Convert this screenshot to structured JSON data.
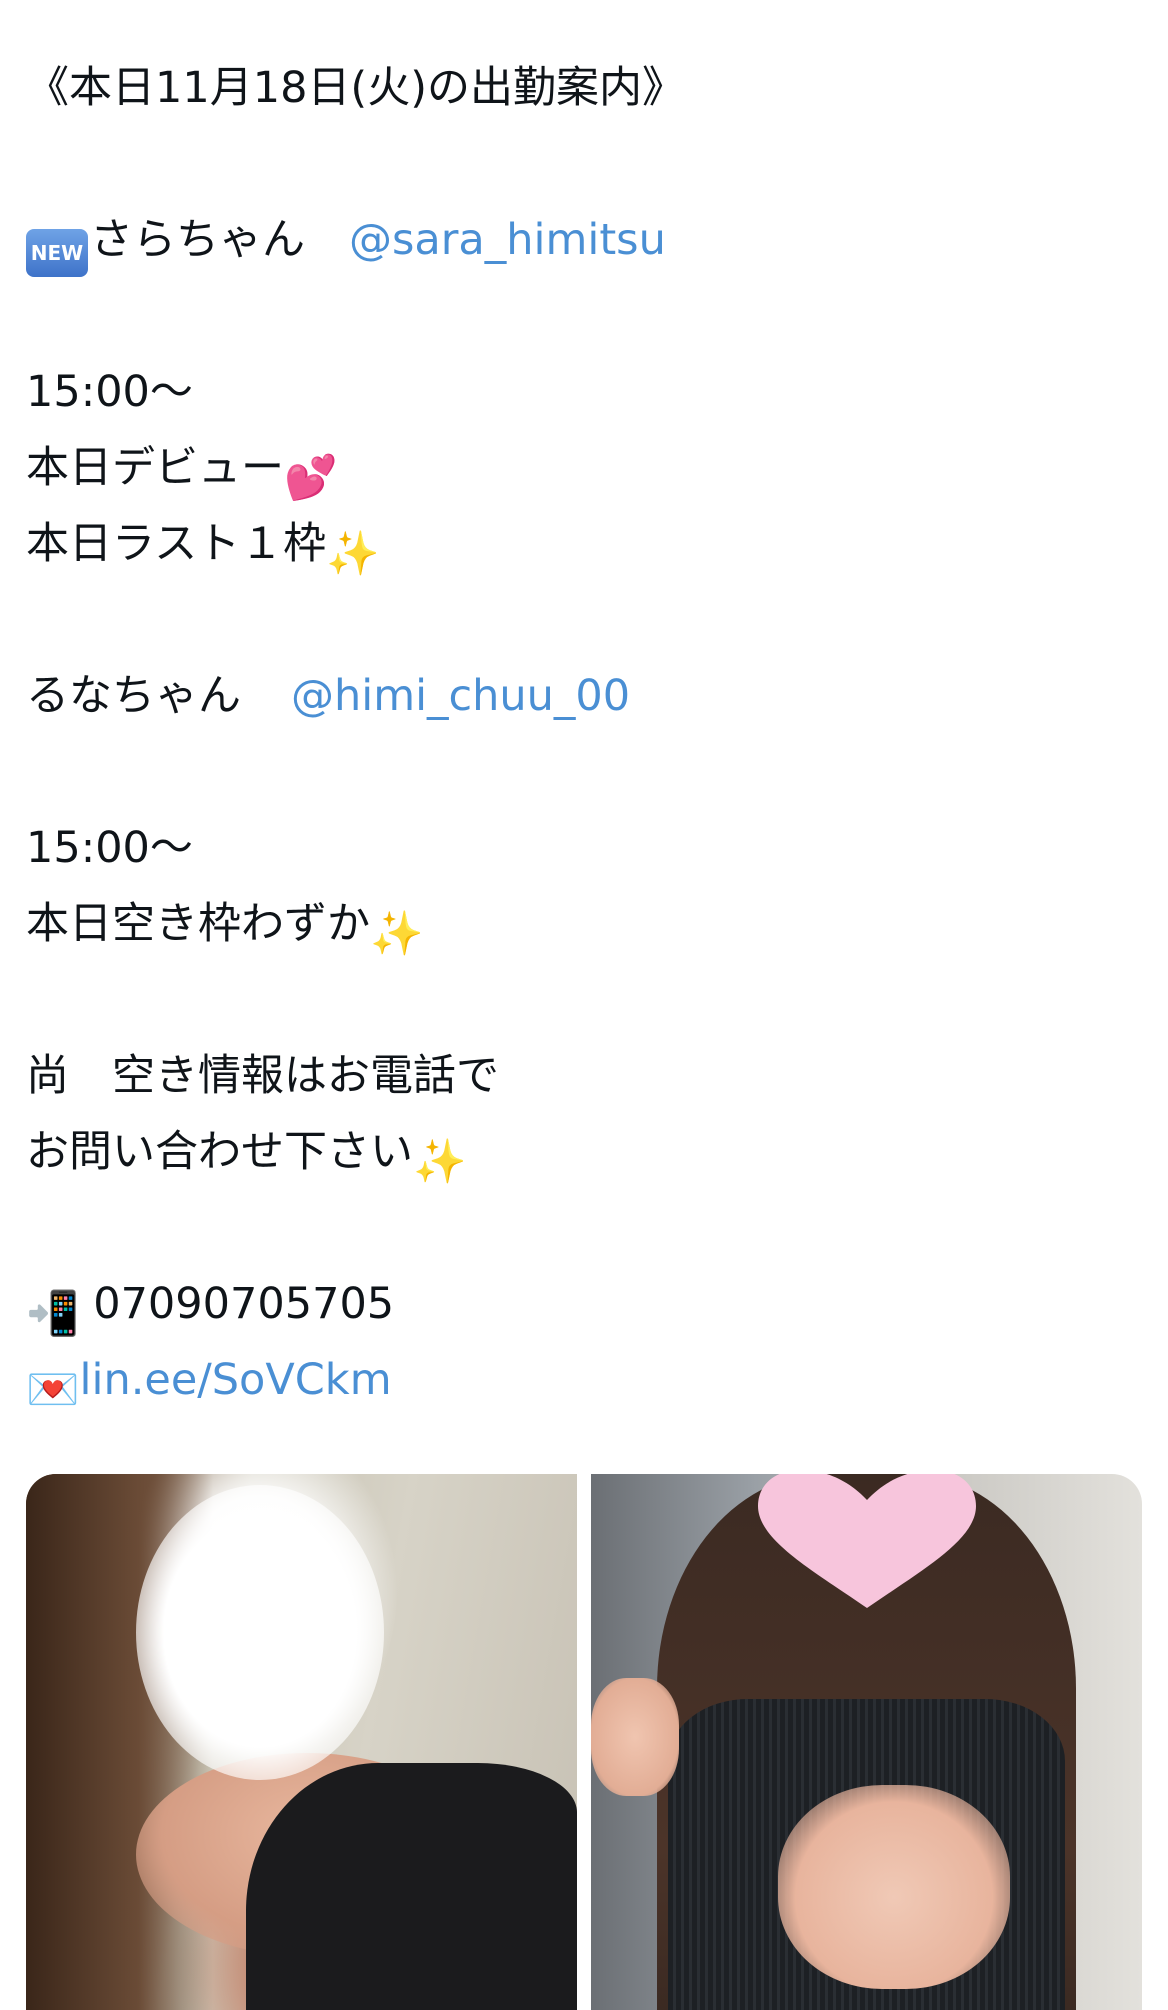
{
  "tweet": {
    "header": "《本日11月18日(火)の出勤案内》",
    "cast1": {
      "badge": "NEW",
      "name": "さらちゃん",
      "handle": "@sara_himitsu",
      "time": "15:00〜",
      "note1": "本日デビュー",
      "note1_emoji": "💕",
      "note2": "本日ラスト１枠",
      "note2_emoji": "✨"
    },
    "cast2": {
      "name": "るなちゃん",
      "handle": "@himi_chuu_00",
      "time": "15:00〜",
      "note1": "本日空き枠わずか",
      "note1_emoji": "✨"
    },
    "notice_line1": "尚　空き情報はお電話で",
    "notice_line2": "お問い合わせ下さい",
    "notice_emoji": "✨",
    "phone_emoji": "📲",
    "phone": "07090705705",
    "line_emoji": "💌",
    "line_link": "lin.ee/SoVCkm"
  },
  "colors": {
    "text": "#0f1419",
    "link": "#4a8fd4",
    "new_badge": "#4a80d6",
    "heart_sticker": "#f7c5dc"
  },
  "media": [
    {
      "name": "photo-left"
    },
    {
      "name": "photo-right"
    }
  ]
}
